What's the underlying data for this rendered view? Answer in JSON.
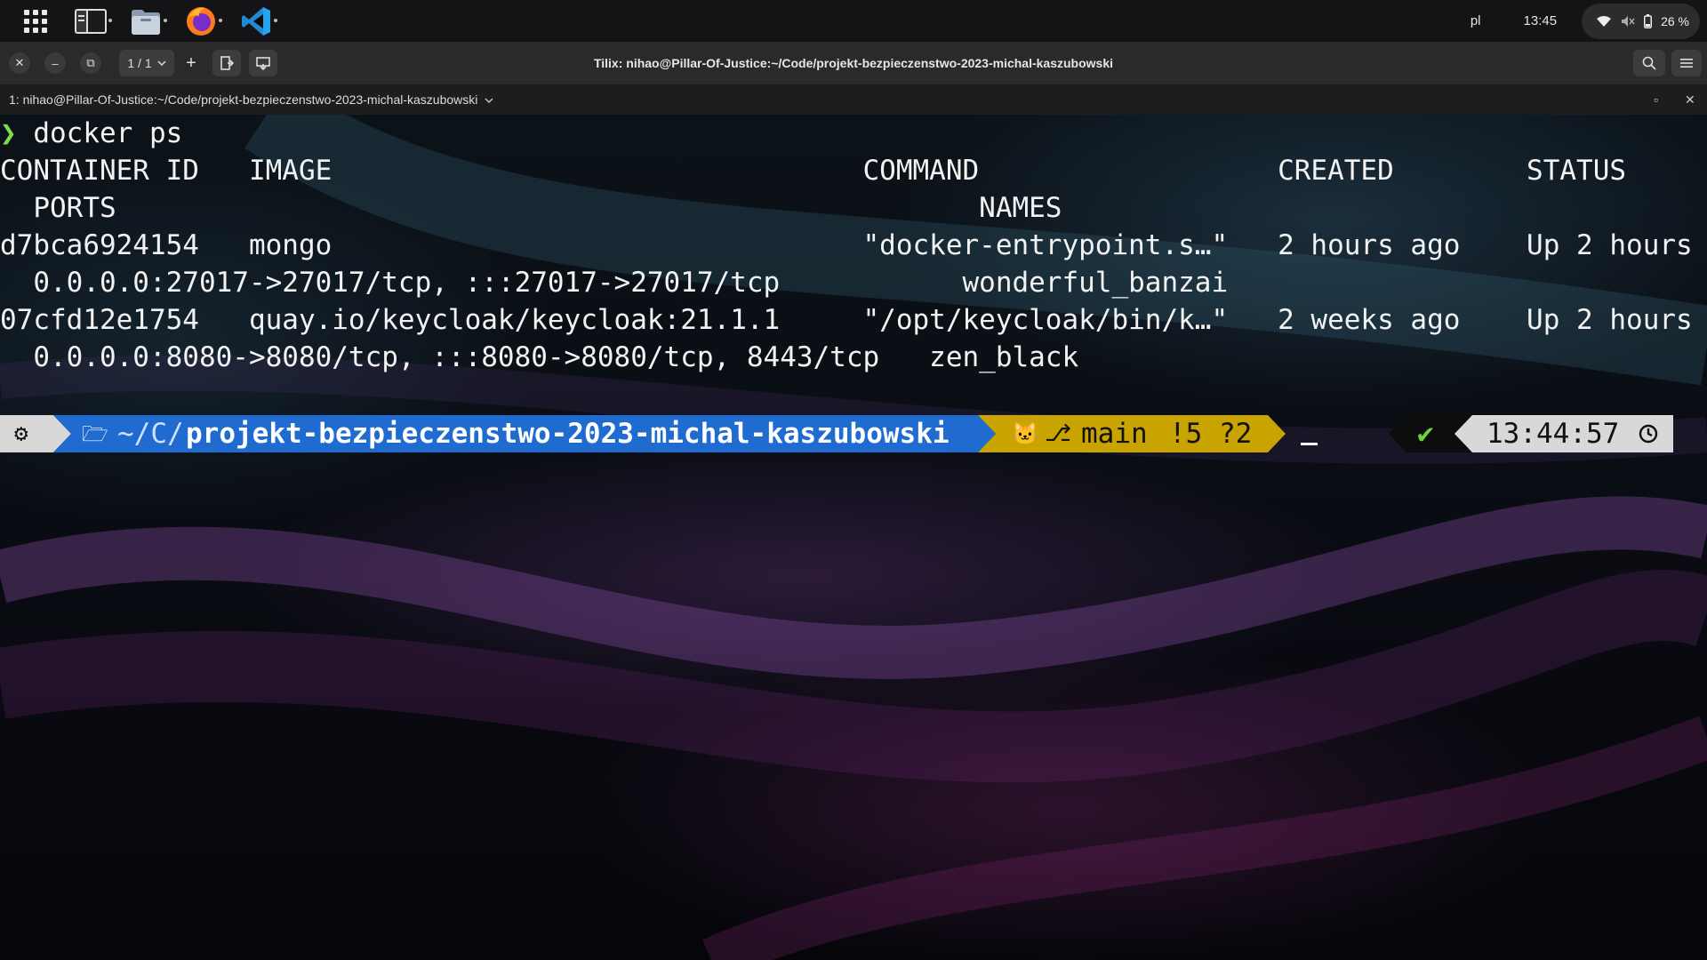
{
  "topbar": {
    "dock": [
      {
        "name": "show-apps",
        "icon": "apps-grid-icon"
      },
      {
        "name": "tilix",
        "icon": "terminal-app-icon",
        "running": true
      },
      {
        "name": "files",
        "icon": "folder-app-icon",
        "running": true
      },
      {
        "name": "firefox",
        "icon": "firefox-icon",
        "running": true
      },
      {
        "name": "vscode",
        "icon": "vscode-icon",
        "running": true
      }
    ],
    "keyboard_layout": "pl",
    "clock": "13:45",
    "battery": "26 %"
  },
  "tilix": {
    "session_selector": "1 / 1",
    "add_label": "+",
    "window_title": "Tilix: nihao@Pillar-Of-Justice:~/Code/projekt-bezpieczenstwo-2023-michal-kaszubowski",
    "terminal_title": "1: nihao@Pillar-Of-Justice:~/Code/projekt-bezpieczenstwo-2023-michal-kaszubowski"
  },
  "terminal": {
    "command": "docker ps",
    "lines": [
      "CONTAINER ID   IMAGE                                COMMAND                  CREATED        STATUS",
      "  PORTS                                                    NAMES",
      "d7bca6924154   mongo                                \"docker-entrypoint.s…\"   2 hours ago    Up 2 hours",
      "  0.0.0.0:27017->27017/tcp, :::27017->27017/tcp           wonderful_banzai",
      "07cfd12e1754   quay.io/keycloak/keycloak:21.1.1     \"/opt/keycloak/bin/k…\"   2 weeks ago    Up 2 hours",
      "  0.0.0.0:8080->8080/tcp, :::8080->8080/tcp, 8443/tcp   zen_black"
    ],
    "prompt": {
      "path_prefix": "~/C/",
      "path_main": "projekt-bezpieczenstwo-2023-michal-kaszubowski",
      "git_branch": "main",
      "git_status": "!5 ?2",
      "exit_ok": "✔",
      "time": "13:44:57"
    },
    "colors": {
      "os_segment": "#d8d8d8",
      "path_segment": "#1f6bcf",
      "git_segment": "#c9a400",
      "status_segment": "#0d0d0d",
      "time_segment": "#d8d8d8",
      "prompt_arrow": "#7fdc4f"
    }
  }
}
